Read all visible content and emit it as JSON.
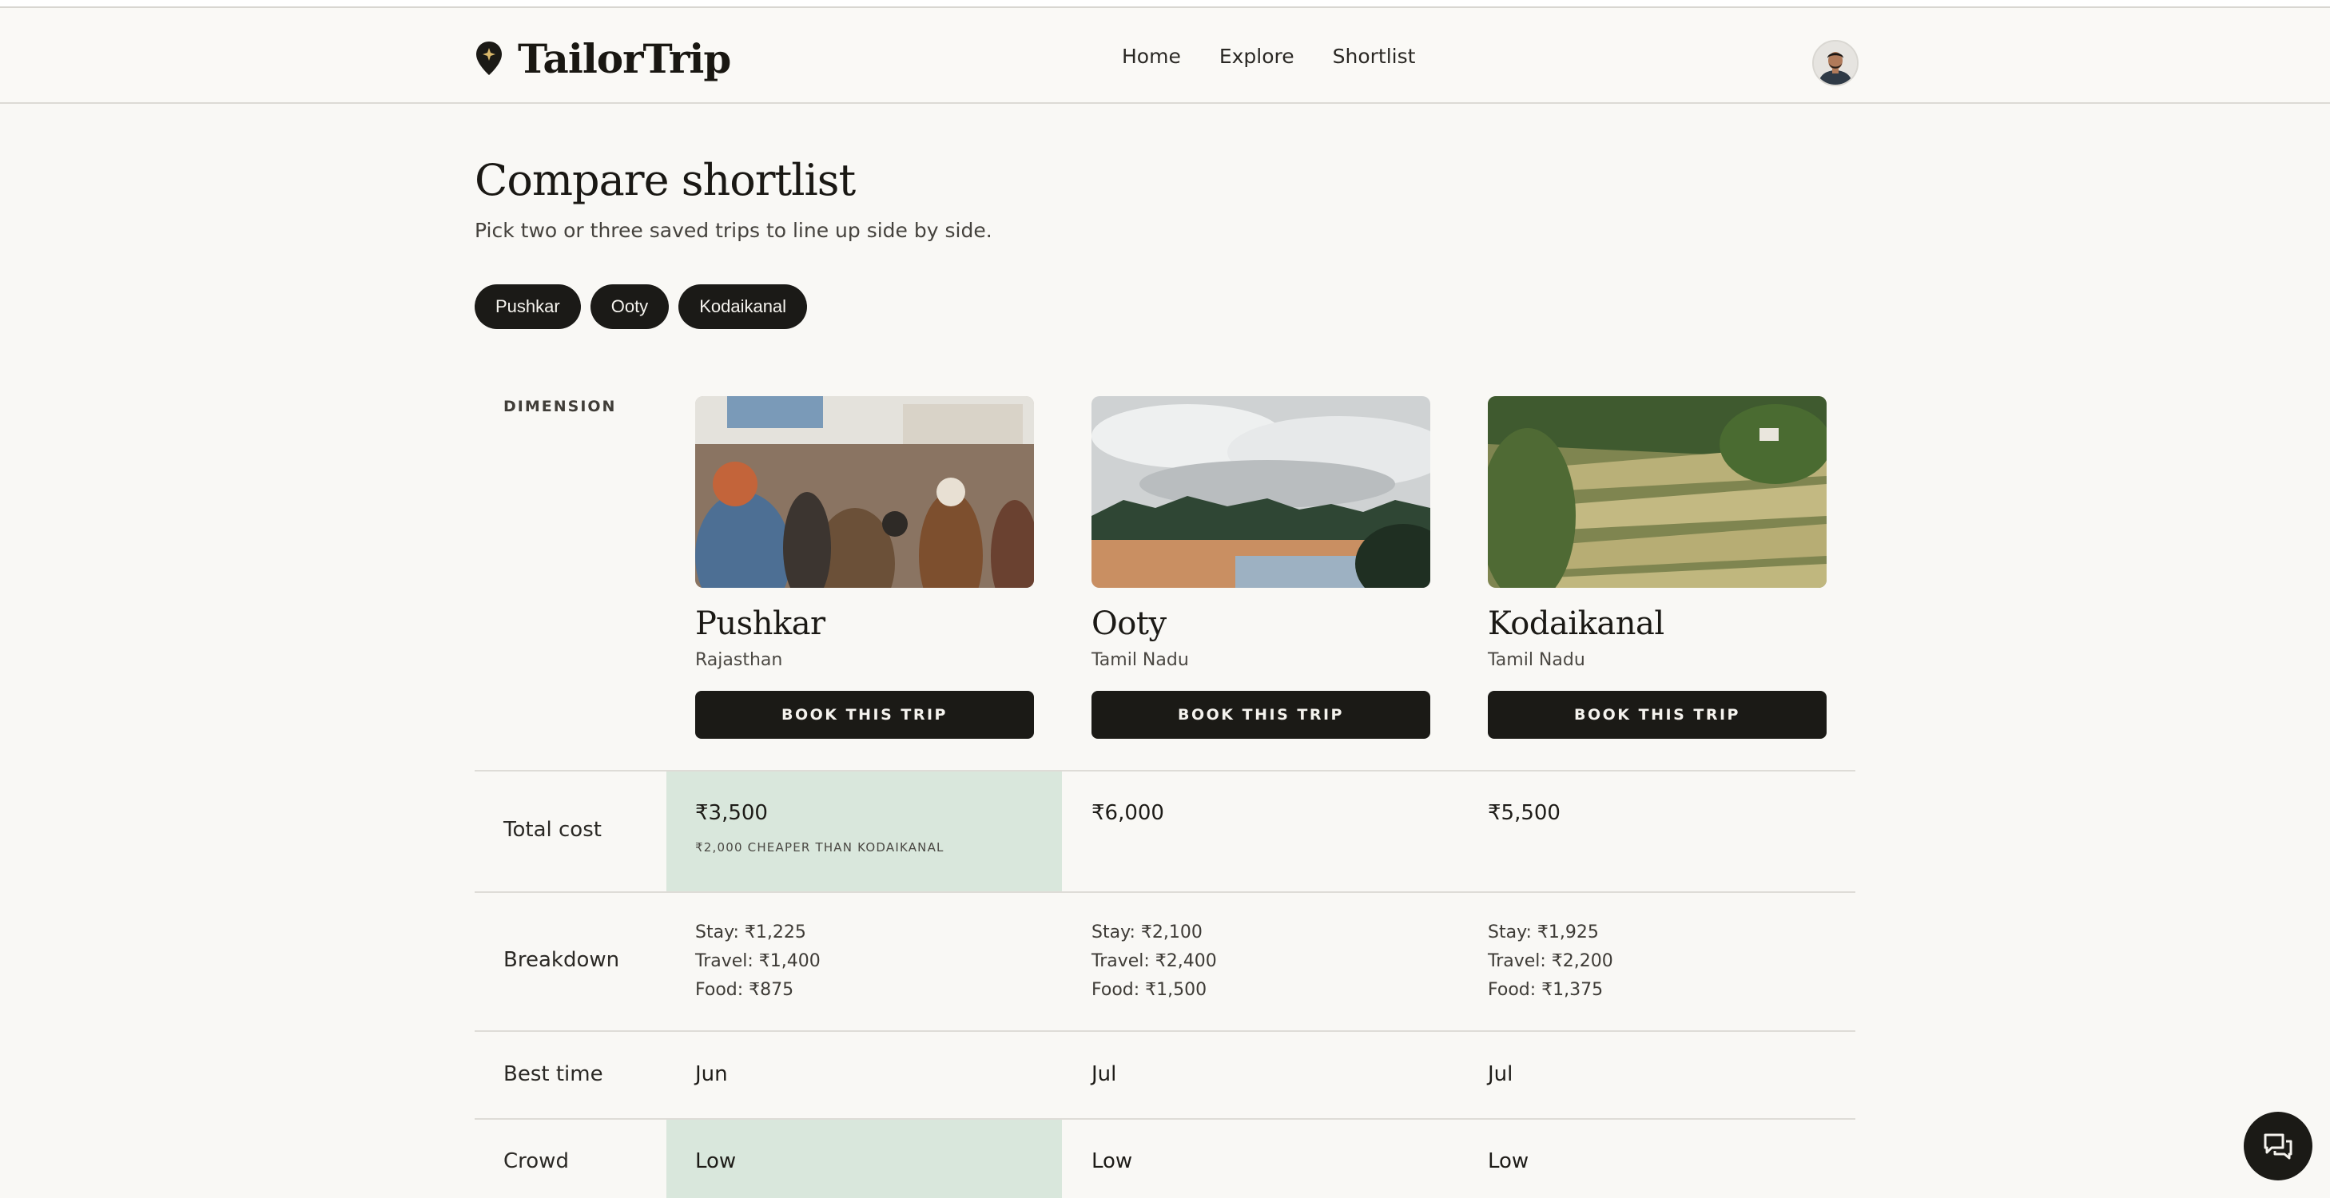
{
  "brand": {
    "name": "TailorTrip",
    "icon": "map-pin-icon"
  },
  "nav": [
    {
      "label": "Home"
    },
    {
      "label": "Explore"
    },
    {
      "label": "Shortlist"
    }
  ],
  "page": {
    "title": "Compare shortlist",
    "subtitle": "Pick two or three saved trips to line up side by side."
  },
  "chips": [
    {
      "label": "Pushkar"
    },
    {
      "label": "Ooty"
    },
    {
      "label": "Kodaikanal"
    }
  ],
  "table": {
    "dimension_header": "DIMENSION",
    "book_label": "BOOK THIS TRIP",
    "trips": [
      {
        "name": "Pushkar",
        "region": "Rajasthan"
      },
      {
        "name": "Ooty",
        "region": "Tamil Nadu"
      },
      {
        "name": "Kodaikanal",
        "region": "Tamil Nadu"
      }
    ],
    "rows": {
      "total_cost": {
        "label": "Total cost",
        "values": [
          "₹3,500",
          "₹6,000",
          "₹5,500"
        ],
        "note": "₹2,000 CHEAPER THAN KODAIKANAL"
      },
      "breakdown": {
        "label": "Breakdown",
        "values": [
          {
            "stay": "Stay: ₹1,225",
            "travel": "Travel: ₹1,400",
            "food": "Food: ₹875"
          },
          {
            "stay": "Stay: ₹2,100",
            "travel": "Travel: ₹2,400",
            "food": "Food: ₹1,500"
          },
          {
            "stay": "Stay: ₹1,925",
            "travel": "Travel: ₹2,200",
            "food": "Food: ₹1,375"
          }
        ]
      },
      "best_time": {
        "label": "Best time",
        "values": [
          "Jun",
          "Jul",
          "Jul"
        ]
      },
      "crowd": {
        "label": "Crowd",
        "values": [
          "Low",
          "Low",
          "Low"
        ]
      }
    }
  },
  "colors": {
    "accent_dark": "#1b1a16",
    "highlight": "#d9e7dc",
    "background": "#f9f8f5"
  }
}
